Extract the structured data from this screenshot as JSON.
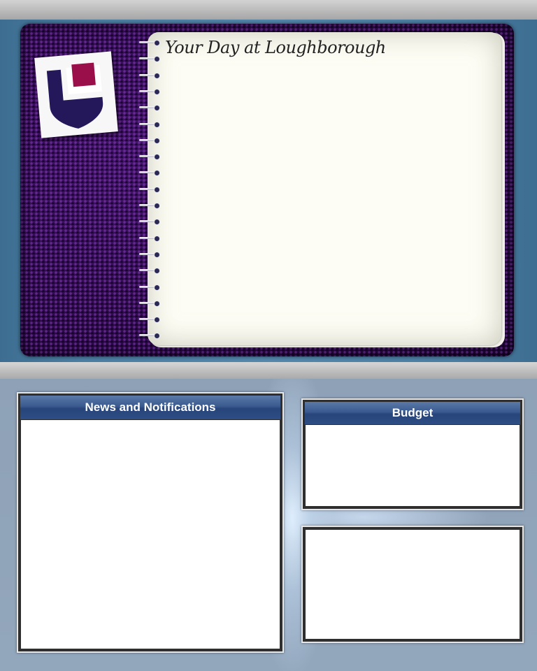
{
  "notebook": {
    "title": "Your Day at Loughborough"
  },
  "panels": {
    "news": {
      "title": "News and Notifications"
    },
    "budget": {
      "title": "Budget"
    }
  },
  "colors": {
    "logo_shield": "#24185a",
    "logo_square": "#9a0f4a",
    "leather": "#2a0b46",
    "panel_header": "#2d4d84"
  }
}
